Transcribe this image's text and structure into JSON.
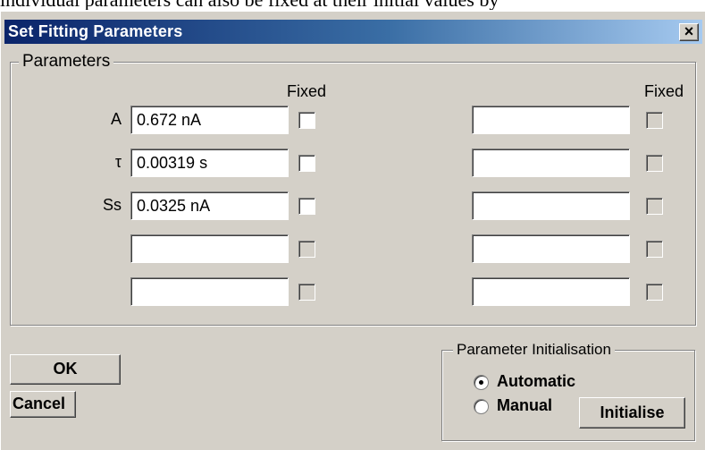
{
  "background_text": "individual parameters can also be fixed at their initial values by",
  "dialog": {
    "title": "Set Fitting Parameters",
    "close_glyph": "×"
  },
  "parameters": {
    "group_label": "Parameters",
    "fixed_header_left": "Fixed",
    "fixed_header_right": "Fixed",
    "left_rows": [
      {
        "label": "A",
        "value": "0.672 nA",
        "fixed": false,
        "enabled": true
      },
      {
        "label": "τ",
        "value": "0.00319 s",
        "fixed": false,
        "enabled": true
      },
      {
        "label": "Ss",
        "value": "0.0325 nA",
        "fixed": false,
        "enabled": true
      },
      {
        "label": "",
        "value": "",
        "fixed": false,
        "enabled": false
      },
      {
        "label": "",
        "value": "",
        "fixed": false,
        "enabled": false
      }
    ],
    "right_rows": [
      {
        "value": "",
        "fixed": false,
        "enabled": false
      },
      {
        "value": "",
        "fixed": false,
        "enabled": false
      },
      {
        "value": "",
        "fixed": false,
        "enabled": false
      },
      {
        "value": "",
        "fixed": false,
        "enabled": false
      },
      {
        "value": "",
        "fixed": false,
        "enabled": false
      }
    ]
  },
  "buttons": {
    "ok_label": "OK",
    "cancel_label": "Cancel",
    "initialise_label": "Initialise"
  },
  "initialisation": {
    "group_label": "Parameter Initialisation",
    "automatic_label": "Automatic",
    "manual_label": "Manual",
    "selected": "Automatic"
  }
}
